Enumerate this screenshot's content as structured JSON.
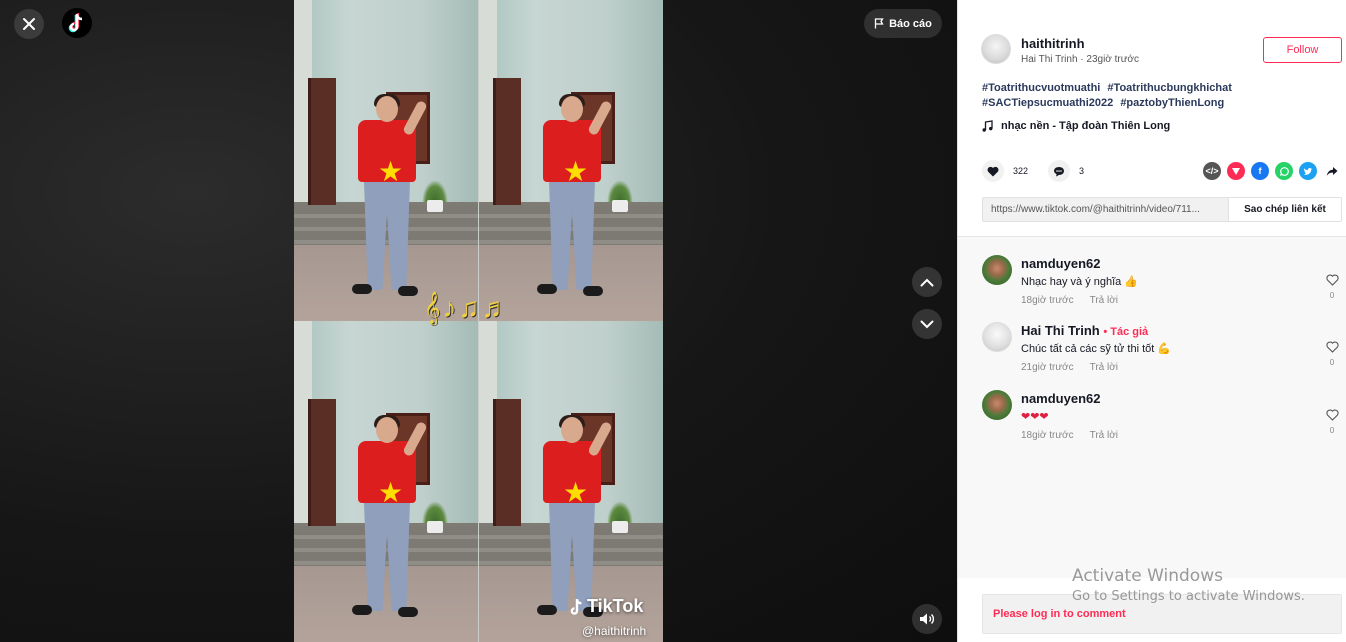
{
  "video": {
    "report_label": "Báo cáo",
    "watermark_brand": "TikTok",
    "watermark_handle": "@haithitrinh"
  },
  "author": {
    "username": "haithitrinh",
    "display_name": "Hai Thi Trinh",
    "time": "23giờ trước",
    "subtitle": "Hai Thi Trinh · 23giờ trước",
    "follow_label": "Follow"
  },
  "caption": {
    "hashtags": [
      "#Toatrithucvuotmuathi",
      "#Toatrithucbungkhichat",
      "#SACTiepsucmuathi2022",
      "#paztobyThienLong"
    ],
    "music": "nhạc nền - Tập đoàn Thiên Long"
  },
  "stats": {
    "likes": "322",
    "comments": "3"
  },
  "share": {
    "icons": [
      "embed-icon",
      "send-icon",
      "facebook-icon",
      "whatsapp-icon",
      "twitter-icon",
      "share-arrow-icon"
    ],
    "colors": {
      "embed": "#555555",
      "send": "#fe2c55",
      "facebook": "#1877f2",
      "whatsapp": "#25d366",
      "twitter": "#1da1f2"
    }
  },
  "link": {
    "url": "https://www.tiktok.com/@haithitrinh/video/711...",
    "copy_label": "Sao chép liên kết"
  },
  "comments": [
    {
      "user": "namduyen62",
      "badge": "",
      "text": "Nhạc hay và ý nghĩa 👍",
      "time": "18giờ trước",
      "reply": "Trả lời",
      "likes": "0"
    },
    {
      "user": "Hai Thi Trinh",
      "badge": "• Tác giả",
      "text": "Chúc tất cả các sỹ tử thi tốt 💪",
      "time": "21giờ trước",
      "reply": "Trả lời",
      "likes": "0"
    },
    {
      "user": "namduyen62",
      "badge": "",
      "text": "❤❤❤",
      "time": "18giờ trước",
      "reply": "Trả lời",
      "likes": "0"
    }
  ],
  "login": {
    "text": "Please log in to comment"
  },
  "watermark_os": {
    "line1": "Activate Windows",
    "line2": "Go to Settings to activate Windows."
  },
  "colors": {
    "accent": "#fe2c55",
    "text": "#161823"
  }
}
